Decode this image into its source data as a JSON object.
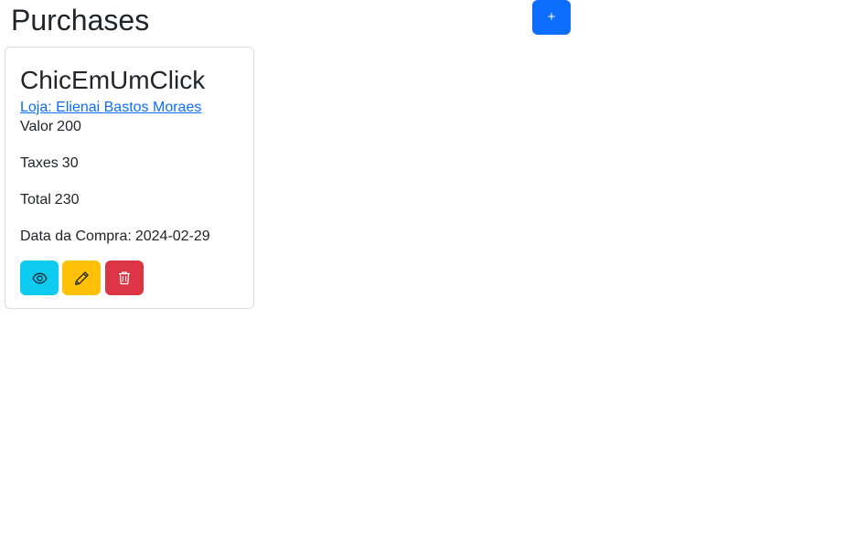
{
  "header": {
    "title": "Purchases",
    "add_button_label": "+"
  },
  "purchases": [
    {
      "name": "ChicEmUmClick",
      "store_label": "Loja:",
      "store_name": "Elienai Bastos Moraes",
      "value_label": "Valor",
      "value": "200",
      "taxes_label": "Taxes",
      "taxes": "30",
      "total_label": "Total",
      "total": "230",
      "date_label": "Data da Compra:",
      "date": "2024-02-29",
      "actions": {
        "view_icon": "eye-icon",
        "edit_icon": "pencil-icon",
        "delete_icon": "trash-icon"
      }
    }
  ],
  "colors": {
    "primary": "#0d6efd",
    "info": "#0dcaf0",
    "warning": "#ffc107",
    "danger": "#dc3545"
  }
}
